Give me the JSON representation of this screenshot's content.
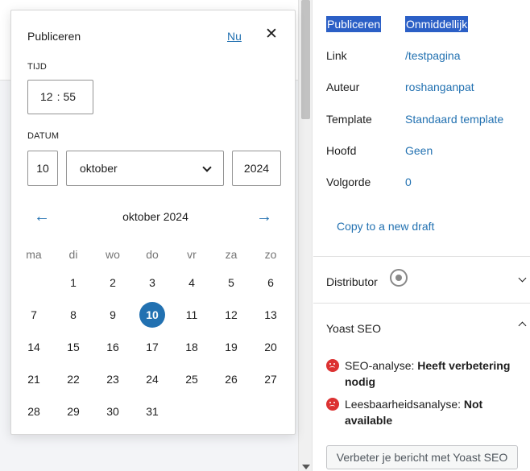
{
  "popover": {
    "title": "Publiceren",
    "now_link": "Nu",
    "close_icon": "close-icon",
    "time_label": "TIJD",
    "hour": "12",
    "time_separator": ":",
    "minute": "55",
    "date_label": "DATUM",
    "day": "10",
    "month": "oktober",
    "year": "2024",
    "month_title": "oktober",
    "month_year": "2024",
    "prev_arrow": "←",
    "next_arrow": "→"
  },
  "calendar": {
    "weekdays": [
      "ma",
      "di",
      "wo",
      "do",
      "vr",
      "za",
      "zo"
    ],
    "weeks": [
      [
        "",
        "1",
        "2",
        "3",
        "4",
        "5",
        "6"
      ],
      [
        "7",
        "8",
        "9",
        "10",
        "11",
        "12",
        "13"
      ],
      [
        "14",
        "15",
        "16",
        "17",
        "18",
        "19",
        "20"
      ],
      [
        "21",
        "22",
        "23",
        "24",
        "25",
        "26",
        "27"
      ],
      [
        "28",
        "29",
        "30",
        "31",
        "",
        "",
        ""
      ]
    ],
    "selected_day": "10",
    "marked_day": "1",
    "accent_color": "#2271b1"
  },
  "sidebar": {
    "rows": [
      {
        "key": "Publiceren",
        "value": "Onmiddellijk"
      },
      {
        "key": "Link",
        "value": "/testpagina"
      },
      {
        "key": "Auteur",
        "value": "roshanganpat"
      },
      {
        "key": "Template",
        "value": "Standaard template"
      },
      {
        "key": "Hoofd",
        "value": "Geen"
      },
      {
        "key": "Volgorde",
        "value": "0"
      }
    ],
    "copy_link": "Copy to a new draft",
    "distributor_title": "Distributor",
    "yoast_title": "Yoast SEO",
    "seo_analysis_label": "SEO-analyse:",
    "seo_analysis_value": "Heeft verbetering nodig",
    "readability_label": "Leesbaarheidsanalyse:",
    "readability_value": "Not available",
    "yoast_button": "Verbeter je bericht met Yoast SEO",
    "link_color": "#2271b1",
    "status_color": "#dc3232"
  }
}
